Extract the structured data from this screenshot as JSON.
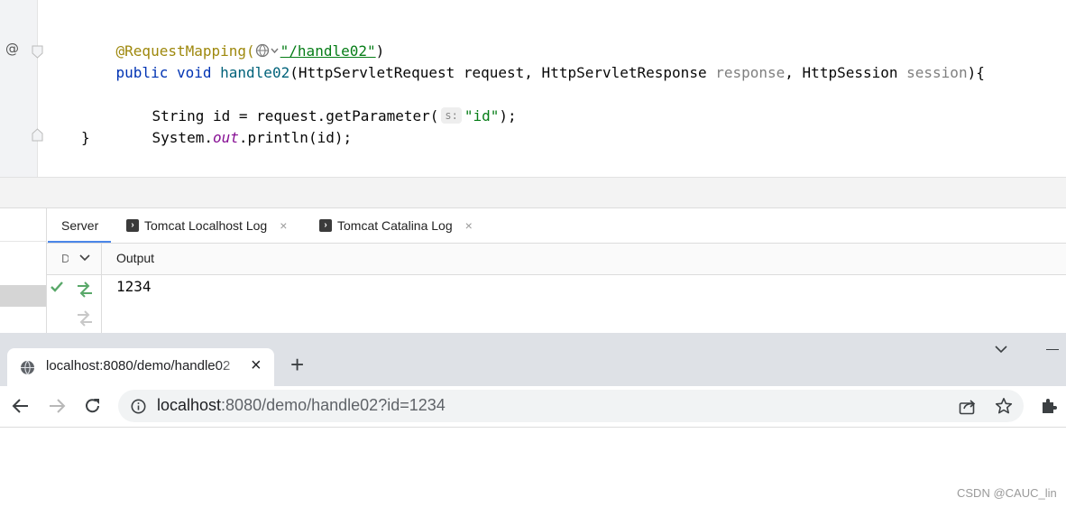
{
  "editor": {
    "line1": {
      "annotation": "@RequestMapping(",
      "path": "\"/handle02\"",
      "close": ")"
    },
    "line2": {
      "kw1": "public",
      "kw2": "void",
      "method": "handle02",
      "params_a": "(HttpServletRequest request, HttpServletResponse ",
      "p_response": "response",
      "comma": ", HttpSession ",
      "p_session": "session",
      "tail": "){"
    },
    "line4": {
      "a": "String id = request.getParameter(",
      "hint": "s:",
      "str": "\"id\"",
      "end": ");"
    },
    "line5": {
      "a": "System.",
      "out": "out",
      "b": ".println(id);"
    },
    "line6": "}",
    "gutter_at": "@"
  },
  "services": {
    "tabs": [
      {
        "label": "Server"
      },
      {
        "label": "Tomcat Localhost Log",
        "close": "×"
      },
      {
        "label": "Tomcat Catalina Log",
        "close": "×"
      }
    ],
    "columns": {
      "d": "D",
      "output": "Output"
    },
    "output_value": "1234"
  },
  "browser": {
    "tab_title": "localhost:8080/demo/handle02",
    "tab_close": "×",
    "new_tab": "+",
    "url_host": "localhost",
    "url_rest": ":8080/demo/handle02?id=1234"
  },
  "watermark": "CSDN @CAUC_lin",
  "colors": {
    "keyword": "#0033b3",
    "annotation": "#9e880d",
    "string": "#067d17",
    "green": "#59a869"
  }
}
